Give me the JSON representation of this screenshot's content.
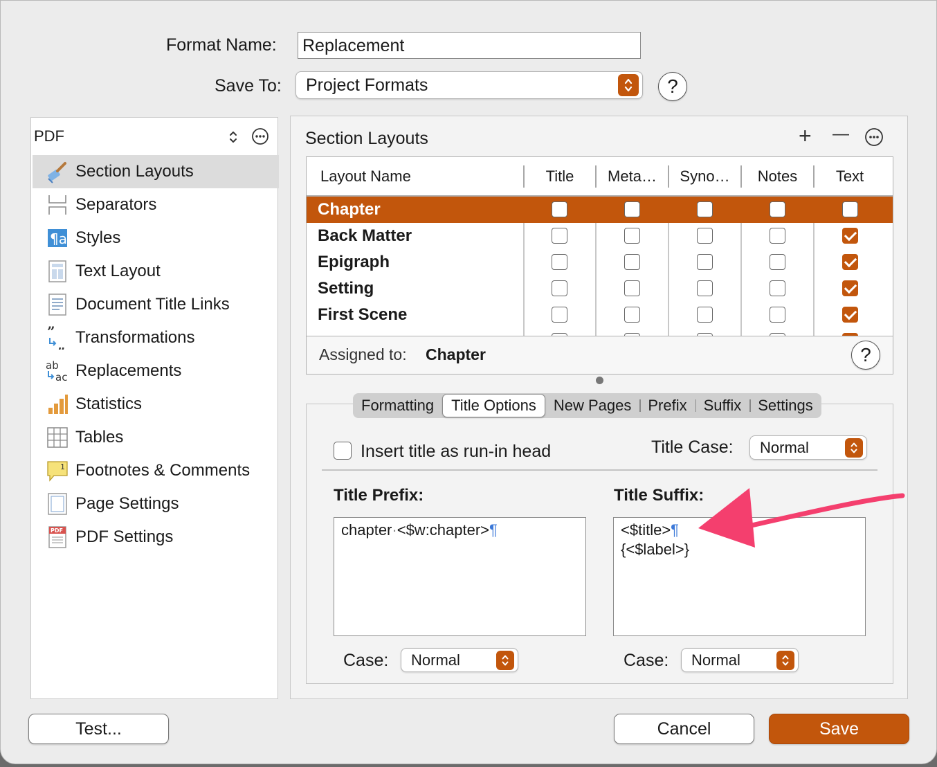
{
  "header": {
    "format_name_label": "Format Name:",
    "format_name_value": "Replacement",
    "save_to_label": "Save To:",
    "save_to_value": "Project Formats",
    "help": "?"
  },
  "sidebar": {
    "selector": "PDF",
    "items": [
      {
        "label": "Section Layouts",
        "icon": "paintbrush-icon",
        "selected": true
      },
      {
        "label": "Separators",
        "icon": "separators-icon"
      },
      {
        "label": "Styles",
        "icon": "styles-icon"
      },
      {
        "label": "Text Layout",
        "icon": "text-layout-icon"
      },
      {
        "label": "Document Title Links",
        "icon": "document-icon"
      },
      {
        "label": "Transformations",
        "icon": "quotes-icon"
      },
      {
        "label": "Replacements",
        "icon": "replace-icon"
      },
      {
        "label": "Statistics",
        "icon": "bar-chart-icon"
      },
      {
        "label": "Tables",
        "icon": "table-icon"
      },
      {
        "label": "Footnotes & Comments",
        "icon": "footnote-icon"
      },
      {
        "label": "Page Settings",
        "icon": "page-icon"
      },
      {
        "label": "PDF Settings",
        "icon": "pdf-icon"
      }
    ]
  },
  "section_layouts": {
    "title": "Section Layouts",
    "add": "+",
    "remove": "—",
    "columns": [
      "Layout Name",
      "Title",
      "Meta…",
      "Syno…",
      "Notes",
      "Text"
    ],
    "rows": [
      {
        "name": "Chapter",
        "checks": [
          false,
          false,
          false,
          false,
          false
        ],
        "selected": true
      },
      {
        "name": "Back Matter",
        "checks": [
          false,
          false,
          false,
          false,
          true
        ]
      },
      {
        "name": "Epigraph",
        "checks": [
          false,
          false,
          false,
          false,
          true
        ]
      },
      {
        "name": "Setting",
        "checks": [
          false,
          false,
          false,
          false,
          true
        ]
      },
      {
        "name": "First Scene",
        "checks": [
          false,
          false,
          false,
          false,
          true
        ]
      }
    ],
    "assigned_label": "Assigned to:",
    "assigned_value": "Chapter"
  },
  "tabs": [
    "Formatting",
    "Title Options",
    "New Pages",
    "Prefix",
    "Suffix",
    "Settings"
  ],
  "selected_tab": "Title Options",
  "title_options": {
    "run_in_label": "Insert title as run-in head",
    "title_case_label": "Title Case:",
    "title_case_value": "Normal",
    "prefix_label": "Title Prefix:",
    "prefix_text": "chapter",
    "prefix_token": "<$w:chapter>",
    "suffix_label": "Title Suffix:",
    "suffix_line1": "<$title>",
    "suffix_line2": "{<$label>}",
    "pilcrow": "¶",
    "case_label": "Case:",
    "prefix_case_value": "Normal",
    "suffix_case_value": "Normal"
  },
  "footer": {
    "test_label": "Test...",
    "cancel_label": "Cancel",
    "save_label": "Save"
  },
  "colors": {
    "accent": "#c2560c",
    "arrow": "#f43f6e",
    "pilcrow": "#3b78d8"
  }
}
